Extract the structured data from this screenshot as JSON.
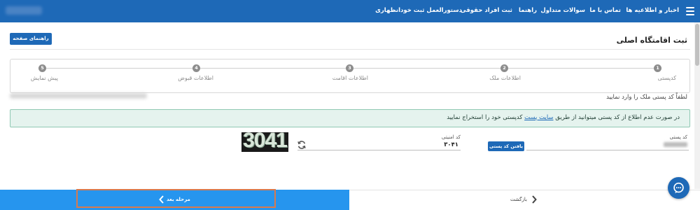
{
  "nav": {
    "items": [
      "اخبار و اطلاعیه ها",
      "تماس با ما",
      "سوالات متداول",
      "راهنما",
      "ثبت افراد حقوقی",
      "دستورالعمل ثبت خودانظهاری"
    ]
  },
  "header": {
    "guide_button": "راهنمای صفحه",
    "title": "ثبت اقامتگاه اصلی"
  },
  "stepper": {
    "steps": [
      {
        "number": "1",
        "label": "کدپستی"
      },
      {
        "number": "2",
        "label": "اطلاعات ملک"
      },
      {
        "number": "3",
        "label": "اطلاعات اقامت"
      },
      {
        "number": "4",
        "label": "اطلاعات قبوض"
      },
      {
        "number": "5",
        "label": "پیش نمایش"
      }
    ]
  },
  "prompt": "لطفاً کد پستی ملک را وارد نمایید",
  "alert": {
    "before_link": "در صورت عدم اطلاع از کد پستی میتوانید از طریق ",
    "link": "سایت پست",
    "after_link": " کدپستی خود را استخراج نمایید"
  },
  "form": {
    "postal_label": "کد پستی",
    "find_postal_button": "یافتن کد پستی",
    "captcha_label": "کد امنیتی",
    "captcha_value": "۳۰۴۱",
    "captcha_image_text": "3041"
  },
  "footer": {
    "next_button": "مرحله بعد",
    "back_button": "بازگشت"
  },
  "colors": {
    "primary": "#1e69b7",
    "next_bar": "#2695ee",
    "alert_bg": "#e5f3ee",
    "highlight_outline": "#d87a4e"
  }
}
